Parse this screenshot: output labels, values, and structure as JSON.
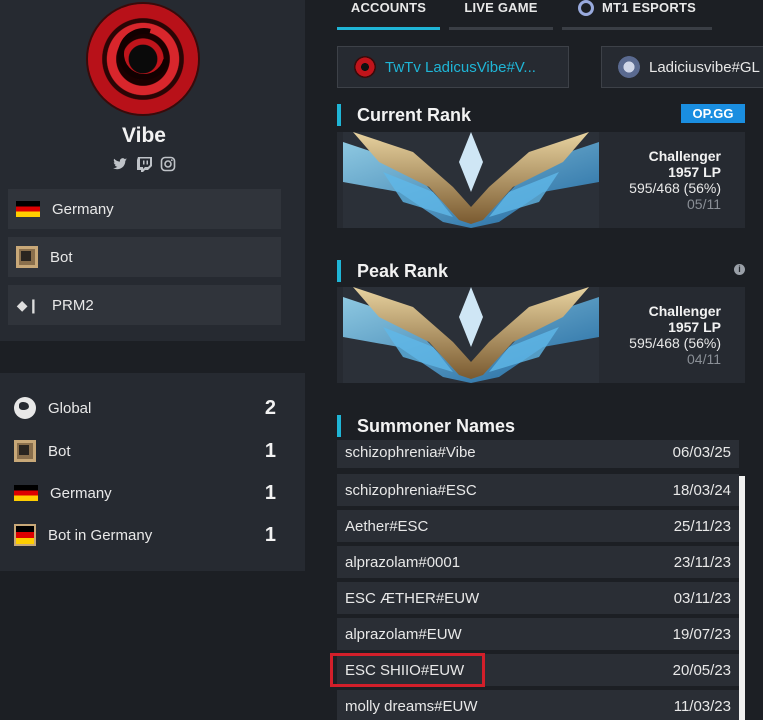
{
  "player": {
    "name": "Vibe",
    "socials": [
      "twitter-icon",
      "twitch-icon",
      "instagram-icon"
    ]
  },
  "info": {
    "country": "Germany",
    "role": "Bot",
    "team": "PRM2"
  },
  "rankings": [
    {
      "label": "Global",
      "value": "2",
      "icon": "globe-icon"
    },
    {
      "label": "Bot",
      "value": "1",
      "icon": "bot-role-icon"
    },
    {
      "label": "Germany",
      "value": "1",
      "icon": "germany-flag-icon"
    },
    {
      "label": "Bot in Germany",
      "value": "1",
      "icon": "bot-germany-icon"
    }
  ],
  "tabs": {
    "accounts": "ACCOUNTS",
    "live_game": "LIVE GAME",
    "esports": "MT1 ESPORTS"
  },
  "accounts": [
    {
      "name": "TwTv LadicusVibe#V...",
      "color": "#1fb5d6"
    },
    {
      "name": "Ladiciusvibe#GL",
      "color": "#e8e8e8"
    }
  ],
  "current_rank": {
    "title": "Current Rank",
    "badge": "OP.GG",
    "tier": "Challenger",
    "lp": "1957 LP",
    "record": "595/468 (56%)",
    "date": "05/11"
  },
  "peak_rank": {
    "title": "Peak Rank",
    "info": "i",
    "tier": "Challenger",
    "lp": "1957 LP",
    "record": "595/468 (56%)",
    "date": "04/11"
  },
  "summoner_names": {
    "title": "Summoner Names",
    "rows": [
      {
        "name": "schizophrenia#Vibe",
        "date": "06/03/25"
      },
      {
        "name": "schizophrenia#ESC",
        "date": "18/03/24"
      },
      {
        "name": "Aether#ESC",
        "date": "25/11/23"
      },
      {
        "name": "alprazolam#0001",
        "date": "23/11/23"
      },
      {
        "name": "ESC ÆTHER#EUW",
        "date": "03/11/23"
      },
      {
        "name": "alprazolam#EUW",
        "date": "19/07/23"
      },
      {
        "name": "ESC SHIIO#EUW",
        "date": "20/05/23"
      },
      {
        "name": "molly dreams#EUW",
        "date": "11/03/23"
      }
    ]
  },
  "colors": {
    "accent": "#1fb5d6",
    "highlight": "#d21f2a",
    "opgg": "#1a8ee0"
  }
}
